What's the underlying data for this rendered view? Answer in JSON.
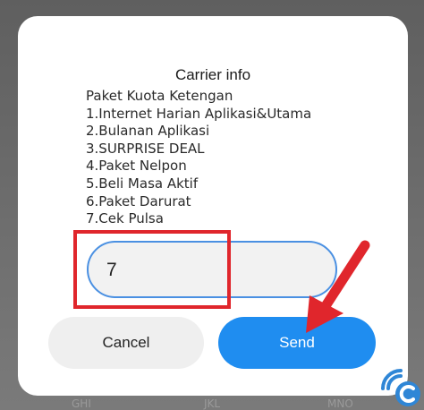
{
  "dialog": {
    "title": "Carrier info",
    "menu_lines": [
      "Paket Kuota Ketengan",
      "1.Internet Harian Aplikasi&Utama",
      "2.Bulanan Aplikasi",
      "3.SURPRISE DEAL",
      "4.Paket Nelpon",
      "5.Beli Masa Aktif",
      "6.Paket Darurat",
      "7.Cek Pulsa"
    ],
    "input": {
      "value": "7",
      "placeholder": ""
    },
    "buttons": {
      "cancel_label": "Cancel",
      "send_label": "Send"
    }
  },
  "keypad_hints": [
    "GHI",
    "JKL",
    "MNO"
  ],
  "colors": {
    "send_button": "#1f8df0",
    "cancel_button": "#efefef",
    "input_border": "#4a90e2",
    "annotation_red": "#e0262c"
  },
  "annotations": {
    "icons": [
      "red-highlight-box",
      "red-arrow-icon",
      "watermark-logo-icon"
    ]
  }
}
